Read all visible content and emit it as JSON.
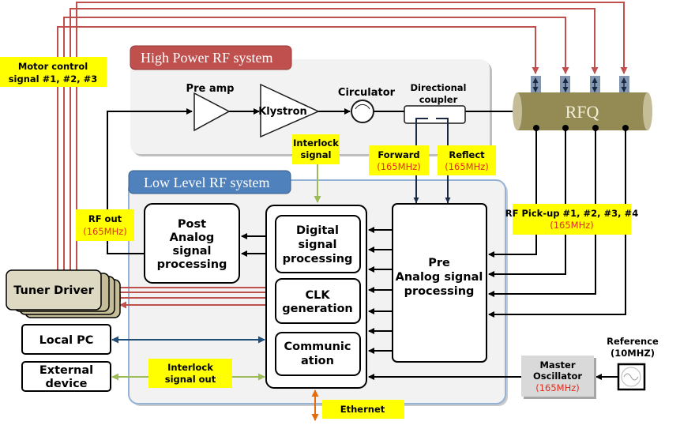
{
  "colors": {
    "high_power": "#c0504d",
    "low_level": "#4f81bd",
    "label_bg": "#ffff00",
    "rfq": "#948a54",
    "motor_line": "#c0504d",
    "pc_line": "#1f4e79",
    "interlock_line": "#9bbb59",
    "ethernet_line": "#e46c0a"
  },
  "high_power": {
    "title": "High Power RF system",
    "pre_amp": "Pre amp",
    "klystron": "Klystron",
    "circulator": "Circulator",
    "coupler": [
      "Directional",
      "coupler"
    ]
  },
  "low_level": {
    "title": "Low Level RF system",
    "post_analog": [
      "Post",
      "Analog",
      "signal",
      "processing"
    ],
    "digital": [
      "Digital",
      "signal",
      "processing"
    ],
    "clk": [
      "CLK",
      "generation"
    ],
    "comm": [
      "Communic",
      "ation"
    ],
    "pre_analog": [
      "Pre",
      "Analog signal",
      "processing"
    ]
  },
  "rfq": "RFQ",
  "labels": {
    "motor": [
      "Motor control",
      "signal #1, #2,  #3"
    ],
    "interlock": [
      "Interlock",
      "signal"
    ],
    "forward": [
      "Forward",
      "(165MHz)"
    ],
    "reflect": [
      "Reflect",
      "(165MHz)"
    ],
    "pickup": [
      "RF Pick-up  #1, #2, #3, #4",
      "(165MHz)"
    ],
    "rf_out": [
      "RF out",
      "(165MHz)"
    ],
    "interlock_out": [
      "Interlock",
      "signal out"
    ],
    "ethernet": "Ethernet"
  },
  "external": {
    "tuner": "Tuner Driver",
    "local_pc": "Local PC",
    "external_device": [
      "External",
      "device"
    ],
    "master_osc": [
      "Master",
      "Oscillator",
      "(165MHz)"
    ],
    "reference": [
      "Reference",
      "(10MHZ)"
    ]
  }
}
